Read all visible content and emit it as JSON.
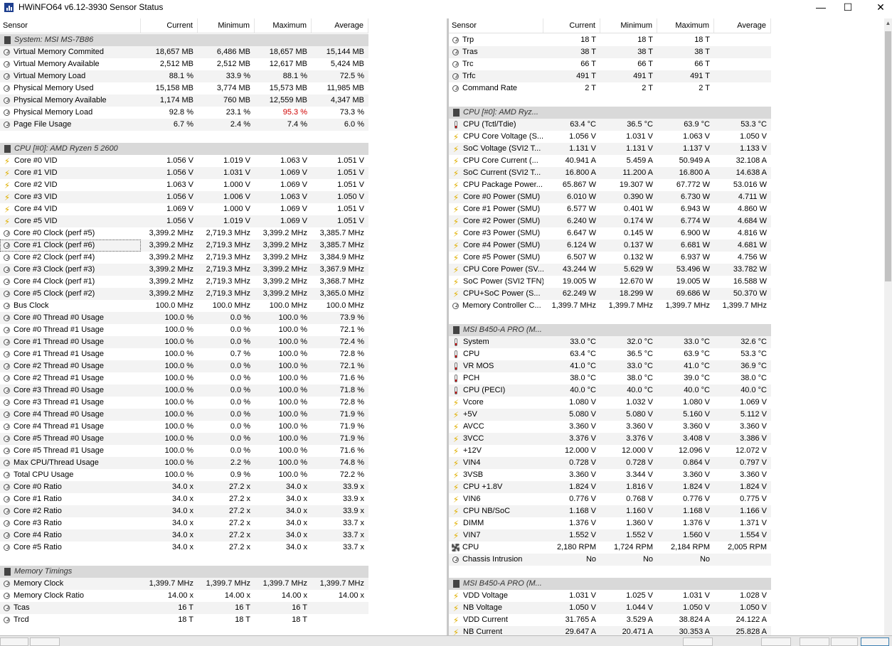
{
  "window": {
    "title": "HWiNFO64 v6.12-3930 Sensor Status"
  },
  "columns": {
    "sensor": "Sensor",
    "current": "Current",
    "minimum": "Minimum",
    "maximum": "Maximum",
    "average": "Average"
  },
  "left_rows": [
    {
      "type": "group",
      "name": "System: MSI MS-7B86"
    },
    {
      "icon": "clock",
      "name": "Virtual Memory Commited",
      "cur": "18,657 MB",
      "min": "6,486 MB",
      "max": "18,657 MB",
      "avg": "15,144 MB"
    },
    {
      "icon": "clock",
      "name": "Virtual Memory Available",
      "cur": "2,512 MB",
      "min": "2,512 MB",
      "max": "12,617 MB",
      "avg": "5,424 MB"
    },
    {
      "icon": "clock",
      "name": "Virtual Memory Load",
      "cur": "88.1 %",
      "min": "33.9 %",
      "max": "88.1 %",
      "avg": "72.5 %"
    },
    {
      "icon": "clock",
      "name": "Physical Memory Used",
      "cur": "15,158 MB",
      "min": "3,774 MB",
      "max": "15,573 MB",
      "avg": "11,985 MB"
    },
    {
      "icon": "clock",
      "name": "Physical Memory Available",
      "cur": "1,174 MB",
      "min": "760 MB",
      "max": "12,559 MB",
      "avg": "4,347 MB"
    },
    {
      "icon": "clock",
      "name": "Physical Memory Load",
      "cur": "92.8 %",
      "min": "23.1 %",
      "max": "95.3 %",
      "avg": "73.3 %",
      "max_red": true
    },
    {
      "icon": "clock",
      "name": "Page File Usage",
      "cur": "6.7 %",
      "min": "2.4 %",
      "max": "7.4 %",
      "avg": "6.0 %"
    },
    {
      "type": "blank"
    },
    {
      "type": "group",
      "name": "CPU [#0]: AMD Ryzen 5 2600"
    },
    {
      "icon": "bolt",
      "name": "Core #0 VID",
      "cur": "1.056 V",
      "min": "1.019 V",
      "max": "1.063 V",
      "avg": "1.051 V"
    },
    {
      "icon": "bolt",
      "name": "Core #1 VID",
      "cur": "1.056 V",
      "min": "1.031 V",
      "max": "1.069 V",
      "avg": "1.051 V"
    },
    {
      "icon": "bolt",
      "name": "Core #2 VID",
      "cur": "1.063 V",
      "min": "1.000 V",
      "max": "1.069 V",
      "avg": "1.051 V"
    },
    {
      "icon": "bolt",
      "name": "Core #3 VID",
      "cur": "1.056 V",
      "min": "1.006 V",
      "max": "1.063 V",
      "avg": "1.050 V"
    },
    {
      "icon": "bolt",
      "name": "Core #4 VID",
      "cur": "1.069 V",
      "min": "1.000 V",
      "max": "1.069 V",
      "avg": "1.051 V"
    },
    {
      "icon": "bolt",
      "name": "Core #5 VID",
      "cur": "1.056 V",
      "min": "1.019 V",
      "max": "1.069 V",
      "avg": "1.051 V"
    },
    {
      "icon": "clock",
      "name": "Core #0 Clock (perf #5)",
      "cur": "3,399.2 MHz",
      "min": "2,719.3 MHz",
      "max": "3,399.2 MHz",
      "avg": "3,385.7 MHz"
    },
    {
      "icon": "clock",
      "name": "Core #1 Clock (perf #6)",
      "cur": "3,399.2 MHz",
      "min": "2,719.3 MHz",
      "max": "3,399.2 MHz",
      "avg": "3,385.7 MHz",
      "selected": true
    },
    {
      "icon": "clock",
      "name": "Core #2 Clock (perf #4)",
      "cur": "3,399.2 MHz",
      "min": "2,719.3 MHz",
      "max": "3,399.2 MHz",
      "avg": "3,384.9 MHz"
    },
    {
      "icon": "clock",
      "name": "Core #3 Clock (perf #3)",
      "cur": "3,399.2 MHz",
      "min": "2,719.3 MHz",
      "max": "3,399.2 MHz",
      "avg": "3,367.9 MHz"
    },
    {
      "icon": "clock",
      "name": "Core #4 Clock (perf #1)",
      "cur": "3,399.2 MHz",
      "min": "2,719.3 MHz",
      "max": "3,399.2 MHz",
      "avg": "3,368.7 MHz"
    },
    {
      "icon": "clock",
      "name": "Core #5 Clock (perf #2)",
      "cur": "3,399.2 MHz",
      "min": "2,719.3 MHz",
      "max": "3,399.2 MHz",
      "avg": "3,365.0 MHz"
    },
    {
      "icon": "clock",
      "name": "Bus Clock",
      "cur": "100.0 MHz",
      "min": "100.0 MHz",
      "max": "100.0 MHz",
      "avg": "100.0 MHz"
    },
    {
      "icon": "clock",
      "name": "Core #0 Thread #0 Usage",
      "cur": "100.0 %",
      "min": "0.0 %",
      "max": "100.0 %",
      "avg": "73.9 %"
    },
    {
      "icon": "clock",
      "name": "Core #0 Thread #1 Usage",
      "cur": "100.0 %",
      "min": "0.0 %",
      "max": "100.0 %",
      "avg": "72.1 %"
    },
    {
      "icon": "clock",
      "name": "Core #1 Thread #0 Usage",
      "cur": "100.0 %",
      "min": "0.0 %",
      "max": "100.0 %",
      "avg": "72.4 %"
    },
    {
      "icon": "clock",
      "name": "Core #1 Thread #1 Usage",
      "cur": "100.0 %",
      "min": "0.7 %",
      "max": "100.0 %",
      "avg": "72.8 %"
    },
    {
      "icon": "clock",
      "name": "Core #2 Thread #0 Usage",
      "cur": "100.0 %",
      "min": "0.0 %",
      "max": "100.0 %",
      "avg": "72.1 %"
    },
    {
      "icon": "clock",
      "name": "Core #2 Thread #1 Usage",
      "cur": "100.0 %",
      "min": "0.0 %",
      "max": "100.0 %",
      "avg": "71.6 %"
    },
    {
      "icon": "clock",
      "name": "Core #3 Thread #0 Usage",
      "cur": "100.0 %",
      "min": "0.0 %",
      "max": "100.0 %",
      "avg": "71.8 %"
    },
    {
      "icon": "clock",
      "name": "Core #3 Thread #1 Usage",
      "cur": "100.0 %",
      "min": "0.0 %",
      "max": "100.0 %",
      "avg": "72.8 %"
    },
    {
      "icon": "clock",
      "name": "Core #4 Thread #0 Usage",
      "cur": "100.0 %",
      "min": "0.0 %",
      "max": "100.0 %",
      "avg": "71.9 %"
    },
    {
      "icon": "clock",
      "name": "Core #4 Thread #1 Usage",
      "cur": "100.0 %",
      "min": "0.0 %",
      "max": "100.0 %",
      "avg": "71.9 %"
    },
    {
      "icon": "clock",
      "name": "Core #5 Thread #0 Usage",
      "cur": "100.0 %",
      "min": "0.0 %",
      "max": "100.0 %",
      "avg": "71.9 %"
    },
    {
      "icon": "clock",
      "name": "Core #5 Thread #1 Usage",
      "cur": "100.0 %",
      "min": "0.0 %",
      "max": "100.0 %",
      "avg": "71.6 %"
    },
    {
      "icon": "clock",
      "name": "Max CPU/Thread Usage",
      "cur": "100.0 %",
      "min": "2.2 %",
      "max": "100.0 %",
      "avg": "74.8 %"
    },
    {
      "icon": "clock",
      "name": "Total CPU Usage",
      "cur": "100.0 %",
      "min": "0.9 %",
      "max": "100.0 %",
      "avg": "72.2 %"
    },
    {
      "icon": "clock",
      "name": "Core #0 Ratio",
      "cur": "34.0 x",
      "min": "27.2 x",
      "max": "34.0 x",
      "avg": "33.9 x"
    },
    {
      "icon": "clock",
      "name": "Core #1 Ratio",
      "cur": "34.0 x",
      "min": "27.2 x",
      "max": "34.0 x",
      "avg": "33.9 x"
    },
    {
      "icon": "clock",
      "name": "Core #2 Ratio",
      "cur": "34.0 x",
      "min": "27.2 x",
      "max": "34.0 x",
      "avg": "33.9 x"
    },
    {
      "icon": "clock",
      "name": "Core #3 Ratio",
      "cur": "34.0 x",
      "min": "27.2 x",
      "max": "34.0 x",
      "avg": "33.7 x"
    },
    {
      "icon": "clock",
      "name": "Core #4 Ratio",
      "cur": "34.0 x",
      "min": "27.2 x",
      "max": "34.0 x",
      "avg": "33.7 x"
    },
    {
      "icon": "clock",
      "name": "Core #5 Ratio",
      "cur": "34.0 x",
      "min": "27.2 x",
      "max": "34.0 x",
      "avg": "33.7 x"
    },
    {
      "type": "blank"
    },
    {
      "type": "group",
      "name": "Memory Timings"
    },
    {
      "icon": "clock",
      "name": "Memory Clock",
      "cur": "1,399.7 MHz",
      "min": "1,399.7 MHz",
      "max": "1,399.7 MHz",
      "avg": "1,399.7 MHz"
    },
    {
      "icon": "clock",
      "name": "Memory Clock Ratio",
      "cur": "14.00 x",
      "min": "14.00 x",
      "max": "14.00 x",
      "avg": "14.00 x"
    },
    {
      "icon": "clock",
      "name": "Tcas",
      "cur": "16 T",
      "min": "16 T",
      "max": "16 T",
      "avg": ""
    },
    {
      "icon": "clock",
      "name": "Trcd",
      "cur": "18 T",
      "min": "18 T",
      "max": "18 T",
      "avg": ""
    }
  ],
  "right_rows": [
    {
      "icon": "clock",
      "name": "Trp",
      "cur": "18 T",
      "min": "18 T",
      "max": "18 T",
      "avg": ""
    },
    {
      "icon": "clock",
      "name": "Tras",
      "cur": "38 T",
      "min": "38 T",
      "max": "38 T",
      "avg": ""
    },
    {
      "icon": "clock",
      "name": "Trc",
      "cur": "66 T",
      "min": "66 T",
      "max": "66 T",
      "avg": ""
    },
    {
      "icon": "clock",
      "name": "Trfc",
      "cur": "491 T",
      "min": "491 T",
      "max": "491 T",
      "avg": ""
    },
    {
      "icon": "clock",
      "name": "Command Rate",
      "cur": "2 T",
      "min": "2 T",
      "max": "2 T",
      "avg": ""
    },
    {
      "type": "blank"
    },
    {
      "type": "group",
      "name": "CPU [#0]: AMD Ryz..."
    },
    {
      "icon": "thermo",
      "name": "CPU (Tctl/Tdie)",
      "cur": "63.4 °C",
      "min": "36.5 °C",
      "max": "63.9 °C",
      "avg": "53.3 °C"
    },
    {
      "icon": "bolt",
      "name": "CPU Core Voltage (S...",
      "cur": "1.056 V",
      "min": "1.031 V",
      "max": "1.063 V",
      "avg": "1.050 V"
    },
    {
      "icon": "bolt",
      "name": "SoC Voltage (SVI2 T...",
      "cur": "1.131 V",
      "min": "1.131 V",
      "max": "1.137 V",
      "avg": "1.133 V"
    },
    {
      "icon": "bolt",
      "name": "CPU Core Current (...",
      "cur": "40.941 A",
      "min": "5.459 A",
      "max": "50.949 A",
      "avg": "32.108 A"
    },
    {
      "icon": "bolt",
      "name": "SoC Current (SVI2 T...",
      "cur": "16.800 A",
      "min": "11.200 A",
      "max": "16.800 A",
      "avg": "14.638 A"
    },
    {
      "icon": "bolt",
      "name": "CPU Package Power...",
      "cur": "65.867 W",
      "min": "19.307 W",
      "max": "67.772 W",
      "avg": "53.016 W"
    },
    {
      "icon": "bolt",
      "name": "Core #0 Power (SMU)",
      "cur": "6.010 W",
      "min": "0.390 W",
      "max": "6.730 W",
      "avg": "4.711 W"
    },
    {
      "icon": "bolt",
      "name": "Core #1 Power (SMU)",
      "cur": "6.577 W",
      "min": "0.401 W",
      "max": "6.943 W",
      "avg": "4.860 W"
    },
    {
      "icon": "bolt",
      "name": "Core #2 Power (SMU)",
      "cur": "6.240 W",
      "min": "0.174 W",
      "max": "6.774 W",
      "avg": "4.684 W"
    },
    {
      "icon": "bolt",
      "name": "Core #3 Power (SMU)",
      "cur": "6.647 W",
      "min": "0.145 W",
      "max": "6.900 W",
      "avg": "4.816 W"
    },
    {
      "icon": "bolt",
      "name": "Core #4 Power (SMU)",
      "cur": "6.124 W",
      "min": "0.137 W",
      "max": "6.681 W",
      "avg": "4.681 W"
    },
    {
      "icon": "bolt",
      "name": "Core #5 Power (SMU)",
      "cur": "6.507 W",
      "min": "0.132 W",
      "max": "6.937 W",
      "avg": "4.756 W"
    },
    {
      "icon": "bolt",
      "name": "CPU Core Power (SV...",
      "cur": "43.244 W",
      "min": "5.629 W",
      "max": "53.496 W",
      "avg": "33.782 W"
    },
    {
      "icon": "bolt",
      "name": "SoC Power (SVI2 TFN)",
      "cur": "19.005 W",
      "min": "12.670 W",
      "max": "19.005 W",
      "avg": "16.588 W"
    },
    {
      "icon": "bolt",
      "name": "CPU+SoC Power (S...",
      "cur": "62.249 W",
      "min": "18.299 W",
      "max": "69.686 W",
      "avg": "50.370 W"
    },
    {
      "icon": "clock",
      "name": "Memory Controller C...",
      "cur": "1,399.7 MHz",
      "min": "1,399.7 MHz",
      "max": "1,399.7 MHz",
      "avg": "1,399.7 MHz"
    },
    {
      "type": "blank"
    },
    {
      "type": "group",
      "name": "MSI B450-A PRO (M..."
    },
    {
      "icon": "thermo",
      "name": "System",
      "cur": "33.0 °C",
      "min": "32.0 °C",
      "max": "33.0 °C",
      "avg": "32.6 °C"
    },
    {
      "icon": "thermo",
      "name": "CPU",
      "cur": "63.4 °C",
      "min": "36.5 °C",
      "max": "63.9 °C",
      "avg": "53.3 °C"
    },
    {
      "icon": "thermo",
      "name": "VR MOS",
      "cur": "41.0 °C",
      "min": "33.0 °C",
      "max": "41.0 °C",
      "avg": "36.9 °C"
    },
    {
      "icon": "thermo",
      "name": "PCH",
      "cur": "38.0 °C",
      "min": "38.0 °C",
      "max": "39.0 °C",
      "avg": "38.0 °C"
    },
    {
      "icon": "thermo",
      "name": "CPU (PECI)",
      "cur": "40.0 °C",
      "min": "40.0 °C",
      "max": "40.0 °C",
      "avg": "40.0 °C"
    },
    {
      "icon": "bolt",
      "name": "Vcore",
      "cur": "1.080 V",
      "min": "1.032 V",
      "max": "1.080 V",
      "avg": "1.069 V"
    },
    {
      "icon": "bolt",
      "name": "+5V",
      "cur": "5.080 V",
      "min": "5.080 V",
      "max": "5.160 V",
      "avg": "5.112 V"
    },
    {
      "icon": "bolt",
      "name": "AVCC",
      "cur": "3.360 V",
      "min": "3.360 V",
      "max": "3.360 V",
      "avg": "3.360 V"
    },
    {
      "icon": "bolt",
      "name": "3VCC",
      "cur": "3.376 V",
      "min": "3.376 V",
      "max": "3.408 V",
      "avg": "3.386 V"
    },
    {
      "icon": "bolt",
      "name": "+12V",
      "cur": "12.000 V",
      "min": "12.000 V",
      "max": "12.096 V",
      "avg": "12.072 V"
    },
    {
      "icon": "bolt",
      "name": "VIN4",
      "cur": "0.728 V",
      "min": "0.728 V",
      "max": "0.864 V",
      "avg": "0.797 V"
    },
    {
      "icon": "bolt",
      "name": "3VSB",
      "cur": "3.360 V",
      "min": "3.344 V",
      "max": "3.360 V",
      "avg": "3.360 V"
    },
    {
      "icon": "bolt",
      "name": "CPU +1.8V",
      "cur": "1.824 V",
      "min": "1.816 V",
      "max": "1.824 V",
      "avg": "1.824 V"
    },
    {
      "icon": "bolt",
      "name": "VIN6",
      "cur": "0.776 V",
      "min": "0.768 V",
      "max": "0.776 V",
      "avg": "0.775 V"
    },
    {
      "icon": "bolt",
      "name": "CPU NB/SoC",
      "cur": "1.168 V",
      "min": "1.160 V",
      "max": "1.168 V",
      "avg": "1.166 V"
    },
    {
      "icon": "bolt",
      "name": "DIMM",
      "cur": "1.376 V",
      "min": "1.360 V",
      "max": "1.376 V",
      "avg": "1.371 V"
    },
    {
      "icon": "bolt",
      "name": "VIN7",
      "cur": "1.552 V",
      "min": "1.552 V",
      "max": "1.560 V",
      "avg": "1.554 V"
    },
    {
      "icon": "fan",
      "name": "CPU",
      "cur": "2,180 RPM",
      "min": "1,724 RPM",
      "max": "2,184 RPM",
      "avg": "2,005 RPM"
    },
    {
      "icon": "clock",
      "name": "Chassis Intrusion",
      "cur": "No",
      "min": "No",
      "max": "No",
      "avg": ""
    },
    {
      "type": "blank"
    },
    {
      "type": "group",
      "name": "MSI B450-A PRO (M..."
    },
    {
      "icon": "bolt",
      "name": "VDD Voltage",
      "cur": "1.031 V",
      "min": "1.025 V",
      "max": "1.031 V",
      "avg": "1.028 V"
    },
    {
      "icon": "bolt",
      "name": "NB Voltage",
      "cur": "1.050 V",
      "min": "1.044 V",
      "max": "1.050 V",
      "avg": "1.050 V"
    },
    {
      "icon": "bolt",
      "name": "VDD Current",
      "cur": "31.765 A",
      "min": "3.529 A",
      "max": "38.824 A",
      "avg": "24.122 A"
    },
    {
      "icon": "bolt",
      "name": "NB Current",
      "cur": "29.647 A",
      "min": "20.471 A",
      "max": "30.353 A",
      "avg": "25.828 A"
    }
  ]
}
